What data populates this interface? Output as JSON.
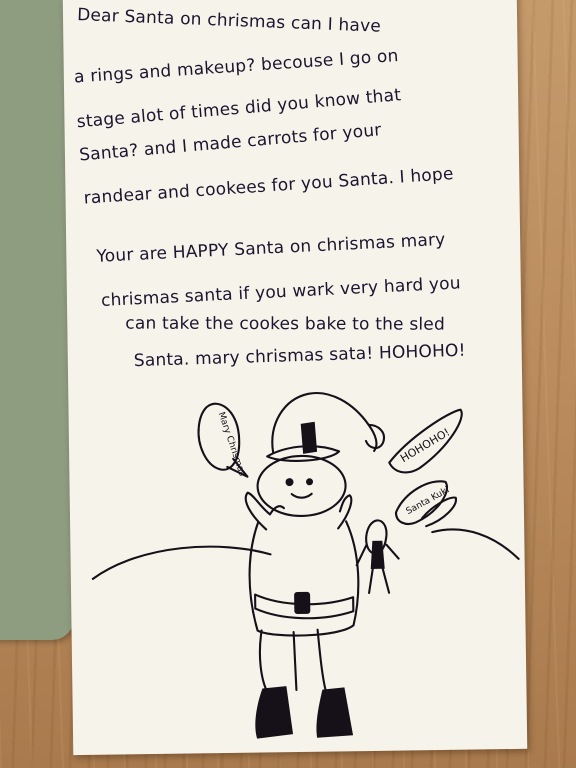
{
  "letter": {
    "lines": [
      "Dear Santa on chrismas can I have",
      "a rings and makeup? becouse I go on",
      "stage alot of times did you know that",
      "Santa? and I made carrots for your",
      "randear and cookees for you Santa. I hope",
      "Your are HAPPY Santa on chrismas mary",
      "chrismas santa if you wark very hard you",
      "can take the cookes bake to the sled",
      "Santa. mary chrismas sata! HOHOHO!"
    ]
  },
  "drawing": {
    "santa_bubble": "Mary Chrismas",
    "elf_shout": "HOHOHO!",
    "elf_bubble": "Santa Kuki"
  },
  "colors": {
    "ink": "#161019",
    "paper": "#f6f3ea",
    "table": "#b98a5c",
    "mat": "#8e9c80"
  }
}
